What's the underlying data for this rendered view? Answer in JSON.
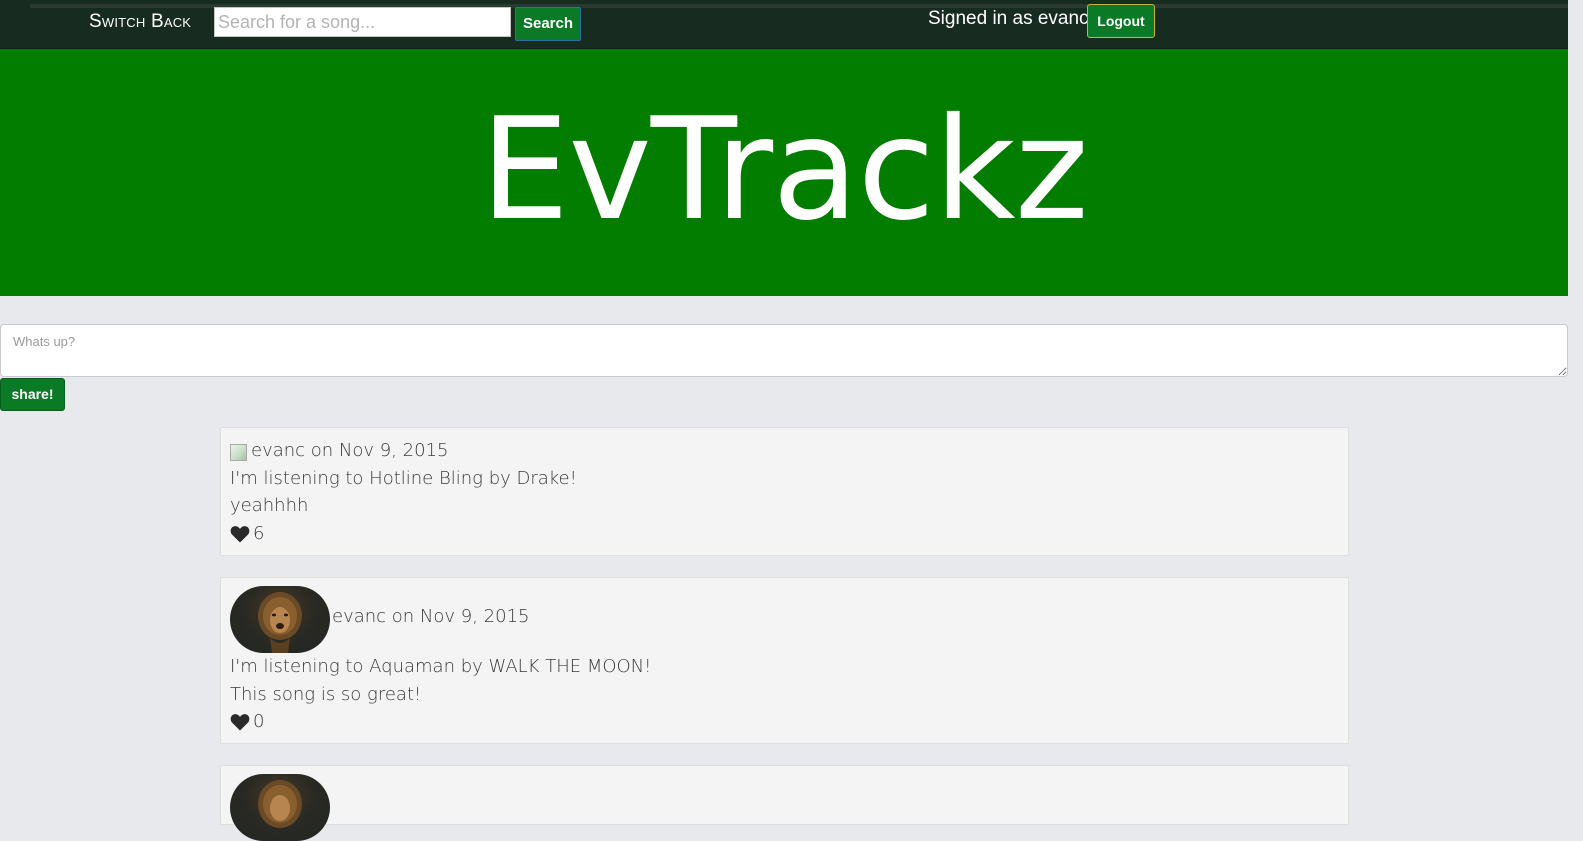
{
  "navbar": {
    "brand": "Switch Back",
    "search_placeholder": "Search for a song...",
    "search_button": "Search",
    "signed_in_text": "Signed in as evanc",
    "logout_button": "Logout"
  },
  "hero": {
    "title": "EvTrackz"
  },
  "composer": {
    "placeholder": "Whats up?",
    "share_button": "share!"
  },
  "colors": {
    "navbar_bg": "#172b21",
    "hero_bg": "#027d00",
    "button_green": "#0b7a26",
    "page_bg": "#e8e9ec"
  },
  "posts": [
    {
      "header": "evanc on Nov 9, 2015",
      "listening": "I'm listening to Hotline Bling by Drake!",
      "message": "yeahhhh",
      "likes": "6",
      "avatar_icon": "broken-image-icon"
    },
    {
      "header": "evanc on Nov 9, 2015",
      "listening": "I'm listening to Aquaman by WALK THE MOON!",
      "message": "This song is so great!",
      "likes": "0",
      "avatar_icon": "lion-avatar"
    }
  ]
}
